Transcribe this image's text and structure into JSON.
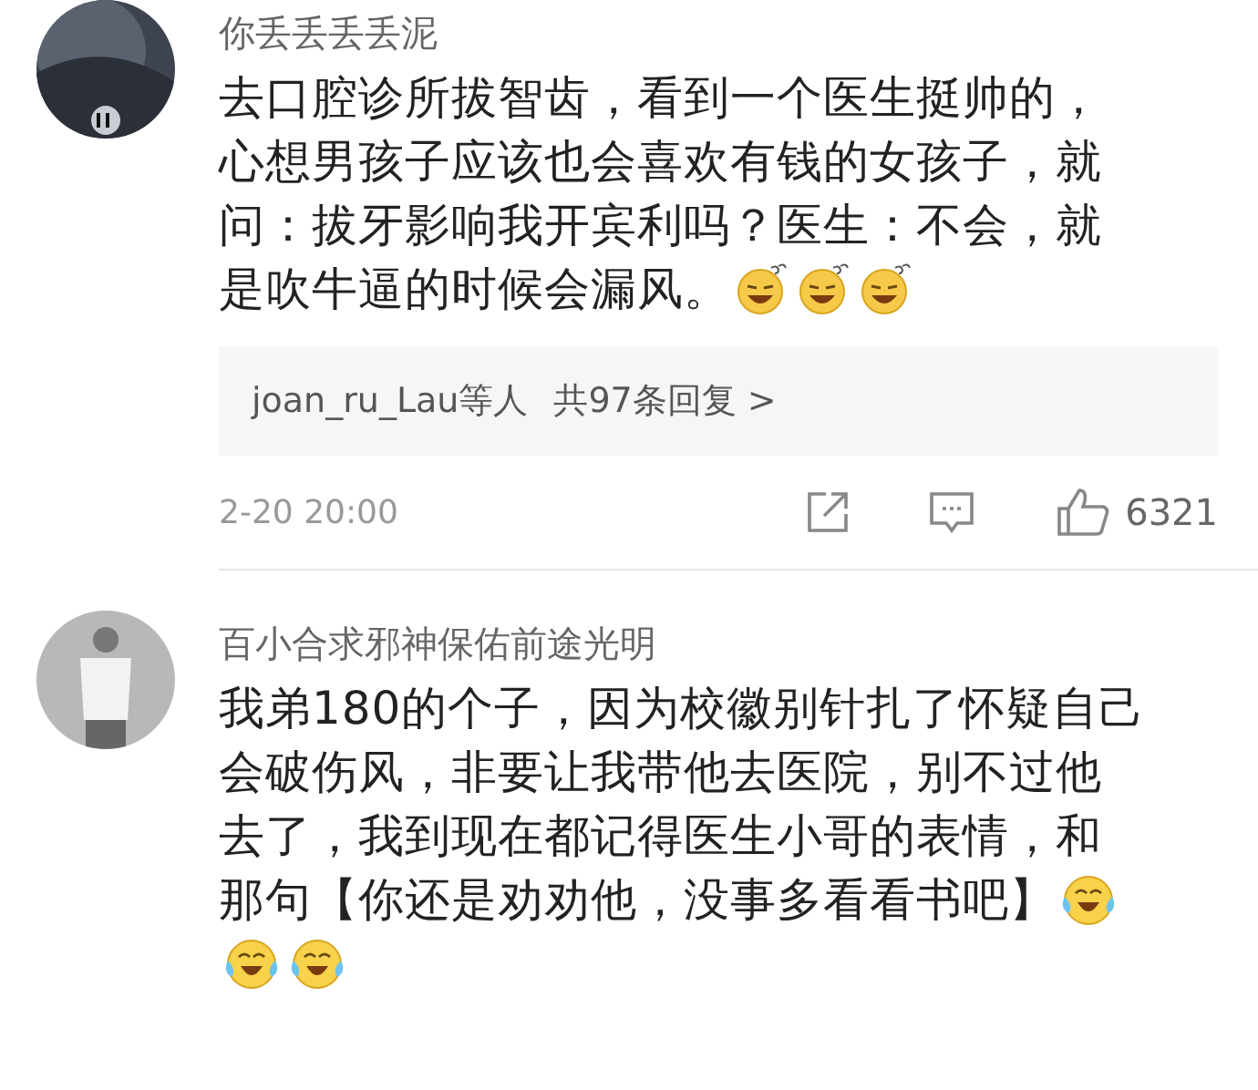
{
  "comments": [
    {
      "username": "你丢丢丢丢泥",
      "lines": [
        {
          "text": "去口腔诊所拔智齿，看到一个医生挺帅的，"
        },
        {
          "text": "心想男孩子应该也会喜欢有钱的女孩子，就"
        },
        {
          "text": "问：拔牙影响我开宾利吗？医生：不会，就"
        },
        {
          "text": "是吹牛逼的时候会漏风。",
          "emojis": [
            {
              "kind": "grin"
            },
            {
              "kind": "grin"
            },
            {
              "kind": "grin"
            }
          ]
        }
      ],
      "replies": {
        "users": "joan_ru_Lau等人",
        "count": "共97条回复 >"
      },
      "time": "2-20 20:00",
      "likes": "6321"
    },
    {
      "username": "百小合求邪神保佑前途光明",
      "lines": [
        {
          "text": "我弟180的个子，因为校徽别针扎了怀疑自己"
        },
        {
          "text": "会破伤风，非要让我带他去医院，别不过他"
        },
        {
          "text": "去了，我到现在都记得医生小哥的表情，和"
        },
        {
          "text": "那句【你还是劝劝他，没事多看看书吧】",
          "emojis": [
            {
              "kind": "laugh-cry"
            }
          ]
        },
        {
          "emojis": [
            {
              "kind": "laugh-cry"
            },
            {
              "kind": "laugh-cry"
            }
          ]
        }
      ]
    }
  ]
}
